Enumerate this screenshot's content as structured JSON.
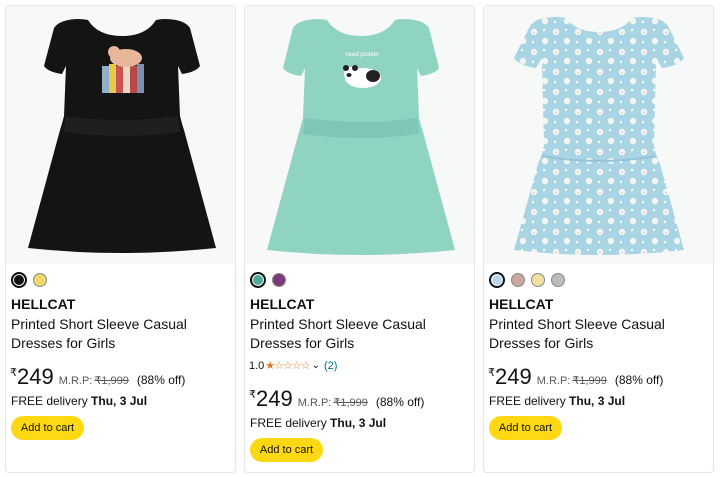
{
  "products": [
    {
      "image": "black-printed-dress-with-cat-on-books",
      "swatch_colors": [
        "#111111",
        "#f2d76b"
      ],
      "brand": "HELLCAT",
      "title": "Printed Short Sleeve Casual Dresses for Girls",
      "rating": null,
      "currency": "₹",
      "price": "249",
      "mrp_label": "M.R.P:",
      "mrp": "₹1,999",
      "discount": "(88% off)",
      "delivery_prefix": "FREE delivery",
      "delivery_date": "Thu, 3 Jul",
      "button": "Add to cart"
    },
    {
      "image": "mint-printed-dress-with-panda",
      "swatch_colors": [
        "#4fa89a",
        "#7a3b78"
      ],
      "brand": "HELLCAT",
      "title": "Printed Short Sleeve Casual Dresses for Girls",
      "rating": {
        "value": "1.0",
        "stars": "★☆☆☆☆",
        "count": "(2)"
      },
      "currency": "₹",
      "price": "249",
      "mrp_label": "M.R.P:",
      "mrp": "₹1,999",
      "discount": "(88% off)",
      "delivery_prefix": "FREE delivery",
      "delivery_date": "Thu, 3 Jul",
      "button": "Add to cart"
    },
    {
      "image": "light-blue-all-over-print-dress",
      "swatch_colors": [
        "#b7d4ea",
        "#c9a99b",
        "#f1df9e",
        "#bcbcbc"
      ],
      "brand": "HELLCAT",
      "title": "Printed Short Sleeve Casual Dresses for Girls",
      "rating": null,
      "currency": "₹",
      "price": "249",
      "mrp_label": "M.R.P:",
      "mrp": "₹1,999",
      "discount": "(88% off)",
      "delivery_prefix": "FREE delivery",
      "delivery_date": "Thu, 3 Jul",
      "button": "Add to cart"
    }
  ],
  "panda_text": "need protein"
}
